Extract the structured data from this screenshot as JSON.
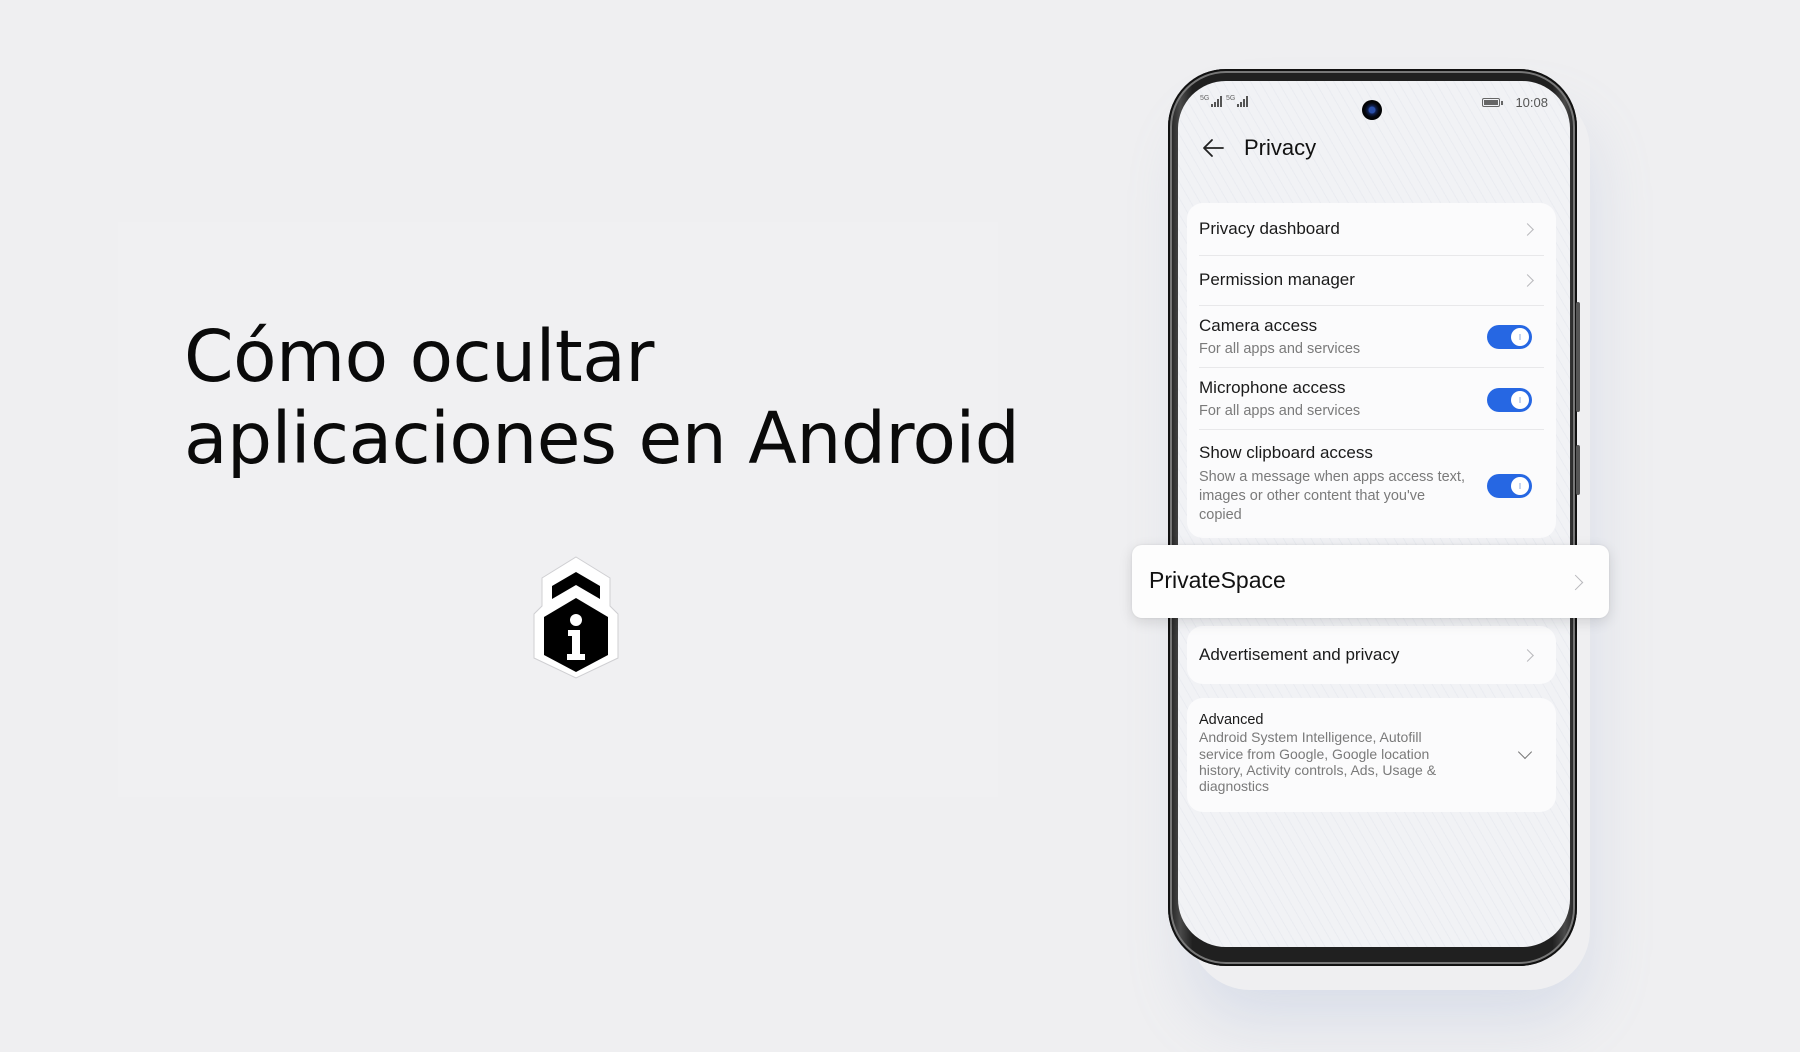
{
  "headline": {
    "line1": "Cómo ocultar",
    "line2": "aplicaciones en Android"
  },
  "badge_icon": "info-shield-lock-icon",
  "phone": {
    "status_bar": {
      "signal_1_label": "5G",
      "signal_2_label": "5G",
      "time": "10:08"
    },
    "header": {
      "back_icon": "arrow-left-icon",
      "title": "Privacy"
    },
    "settings": {
      "items": [
        {
          "label": "Privacy dashboard",
          "control": "chevron"
        },
        {
          "label": "Permission manager",
          "control": "chevron"
        },
        {
          "label": "Camera access",
          "subtitle": "For all apps and services",
          "control": "toggle",
          "enabled": true
        },
        {
          "label": "Microphone access",
          "subtitle": "For all apps and services",
          "control": "toggle",
          "enabled": true
        },
        {
          "label": "Show clipboard access",
          "subtitle_lines": [
            "Show a message when apps access text,",
            "images or other content that you've",
            "copied"
          ],
          "control": "toggle",
          "enabled": true
        }
      ],
      "highlighted": {
        "label": "PrivateSpace",
        "control": "chevron"
      },
      "advertisement": {
        "label": "Advertisement and privacy",
        "control": "chevron"
      },
      "advanced": {
        "label": "Advanced",
        "description_lines": [
          "Android System Intelligence, Autofill",
          "service from Google, Google location",
          "history, Activity controls, Ads, Usage &",
          "diagnostics"
        ],
        "control": "chevron-down"
      }
    }
  },
  "colors": {
    "background": "#efeff1",
    "toggle_on": "#2667e3",
    "text_primary": "#111111",
    "text_secondary": "#7a7a7a"
  }
}
